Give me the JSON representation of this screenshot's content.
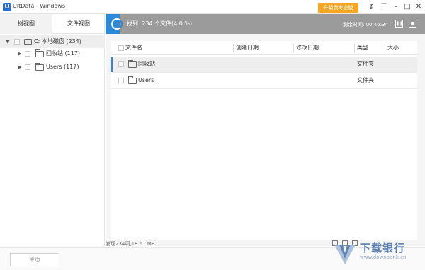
{
  "window": {
    "logo_letter": "U",
    "title": "UltData - Windows",
    "upgrade_label": "升级到专业版"
  },
  "title_icons": [
    "key-icon",
    "menu-icon",
    "minimize-icon",
    "maximize-icon",
    "close-icon"
  ],
  "left_panel": {
    "tabs": [
      {
        "label": "树视图",
        "active": true
      },
      {
        "label": "文件视图",
        "active": false
      }
    ],
    "tree": [
      {
        "label": "C: 本地磁盘 (234)",
        "type": "drive",
        "level": 0,
        "expanded": true,
        "selected": true
      },
      {
        "label": "回收站 (117)",
        "type": "folder",
        "level": 1,
        "expanded": false,
        "selected": false
      },
      {
        "label": "Users (117)",
        "type": "folder",
        "level": 1,
        "expanded": false,
        "selected": false
      }
    ]
  },
  "scan": {
    "found_text": "找到: 234 个文件(4.0 %)",
    "remaining_label": "剩余时间: 00:46:34",
    "pause_icon": "pause-icon",
    "stop_icon": "stop-icon",
    "accent_color": "#2d88d8"
  },
  "table": {
    "columns": [
      "文件名",
      "创建日期",
      "修改日期",
      "类型",
      "大小"
    ],
    "rows": [
      {
        "name": "回收站",
        "created": "",
        "modified": "",
        "type": "文件夹",
        "size": "",
        "selected": true
      },
      {
        "name": "Users",
        "created": "",
        "modified": "",
        "type": "文件夹",
        "size": "",
        "selected": false
      }
    ]
  },
  "status": {
    "text": "发现234项,18.61 MB",
    "view_icons": [
      "list-view-icon",
      "grid-view-icon",
      "detail-view-icon"
    ]
  },
  "bottom": {
    "home_label": "主页"
  },
  "watermark": {
    "title": "下载银行",
    "url": "www.downbank.cn"
  }
}
